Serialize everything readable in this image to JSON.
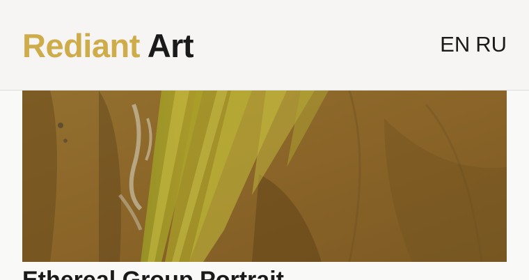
{
  "header": {
    "logo_accent": "Rediant",
    "logo_main": "Art",
    "languages": [
      "EN",
      "RU"
    ]
  },
  "artwork": {
    "title": "Ethereal Group Portrait"
  },
  "colors": {
    "accent": "#cfac4a",
    "text": "#1a1a1a",
    "header_bg": "#f6f5f3",
    "page_bg": "#f9f9f8"
  }
}
